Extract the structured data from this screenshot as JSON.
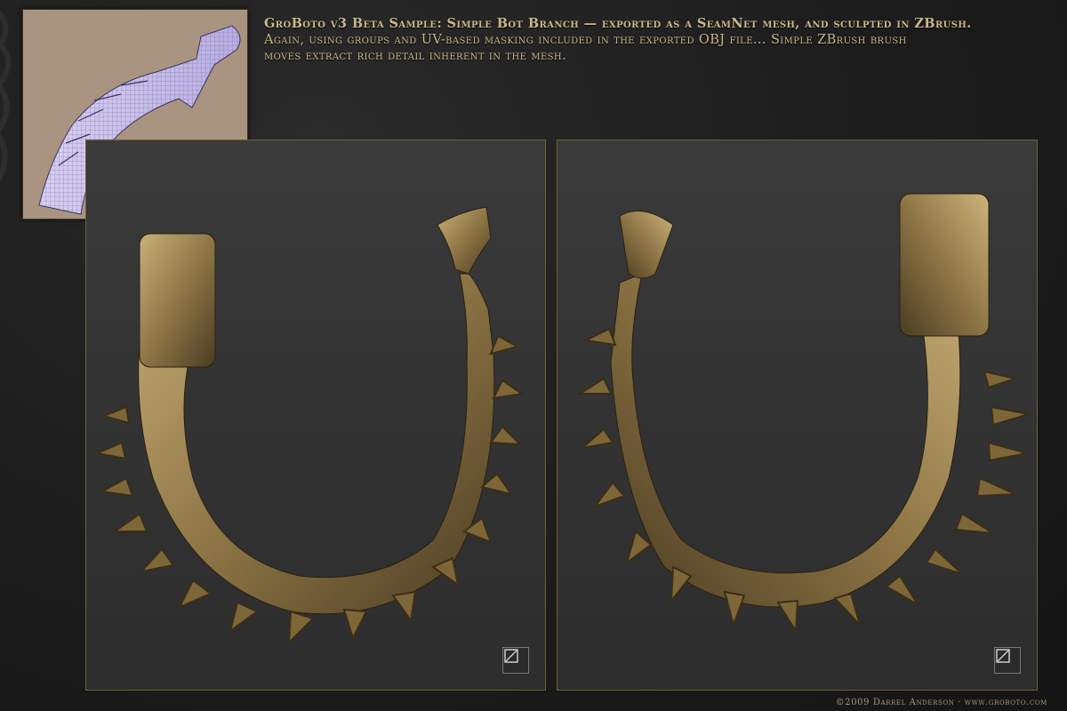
{
  "caption": {
    "line1": "GroBoto v3 Beta Sample: Simple Bot Branch — exported as a SeamNet mesh, and sculpted in ZBrush.",
    "line2": "Again, using groups and UV-based masking included in the exported OBJ file... Simple ZBrush brush",
    "line3": "moves extract rich detail inherent in the mesh."
  },
  "footer": {
    "credit": "©2009 Darrel Anderson · www.groboto.com"
  },
  "icons": {
    "thumbnail": "wireframe-mesh-preview",
    "logo": "groboto-logo-icon"
  },
  "colors": {
    "caption": "#c8b98a",
    "panel_border": "#6e6032",
    "bronze": "#9a8350",
    "thumb_bg": "#a89480"
  }
}
